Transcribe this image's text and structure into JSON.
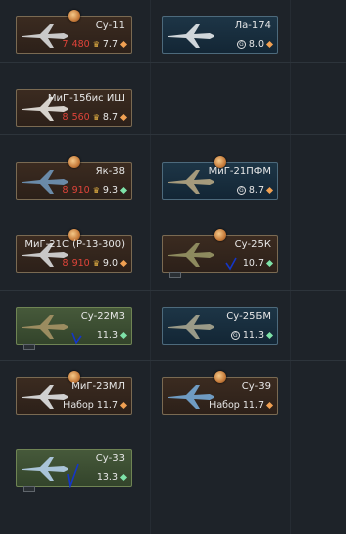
{
  "vehicles": {
    "su11": {
      "name": "Су-11",
      "cost": "7 480",
      "br": "7.7",
      "icon": "jet-plane-icon"
    },
    "la174": {
      "name": "Ла-174",
      "br": "8.0",
      "icon": "jet-plane-icon"
    },
    "mig15bis": {
      "name": "МиГ-15бис ИШ",
      "cost": "8 560",
      "br": "8.7",
      "icon": "jet-plane-icon"
    },
    "yak38": {
      "name": "Як-38",
      "cost": "8 910",
      "br": "9.3",
      "icon": "jet-plane-icon"
    },
    "mig21pfm": {
      "name": "МиГ-21ПФМ",
      "br": "8.7",
      "icon": "jet-plane-icon"
    },
    "mig21s": {
      "name": "МиГ-21С (Р-13-300)",
      "cost": "8 910",
      "br": "9.0",
      "icon": "jet-plane-icon"
    },
    "su25k": {
      "name": "Су-25К",
      "br": "10.7",
      "icon": "jet-plane-icon"
    },
    "su22m3": {
      "name": "Су-22М3",
      "br": "11.3",
      "icon": "jet-plane-icon"
    },
    "su25bm": {
      "name": "Су-25БМ",
      "br": "11.3",
      "icon": "jet-plane-icon"
    },
    "mig23ml": {
      "name": "МиГ-23МЛ",
      "set_label": "Набор",
      "br": "11.7",
      "icon": "jet-plane-icon"
    },
    "su39": {
      "name": "Су-39",
      "set_label": "Набор",
      "br": "11.7",
      "icon": "jet-plane-icon"
    },
    "su33": {
      "name": "Су-33",
      "br": "13.3",
      "icon": "jet-plane-icon"
    }
  },
  "colors": {
    "cost": "#e0443a",
    "br_diamond_orange": "#f0a052",
    "br_diamond_green": "#7ee2a8",
    "checkmark": "#1436c8"
  }
}
